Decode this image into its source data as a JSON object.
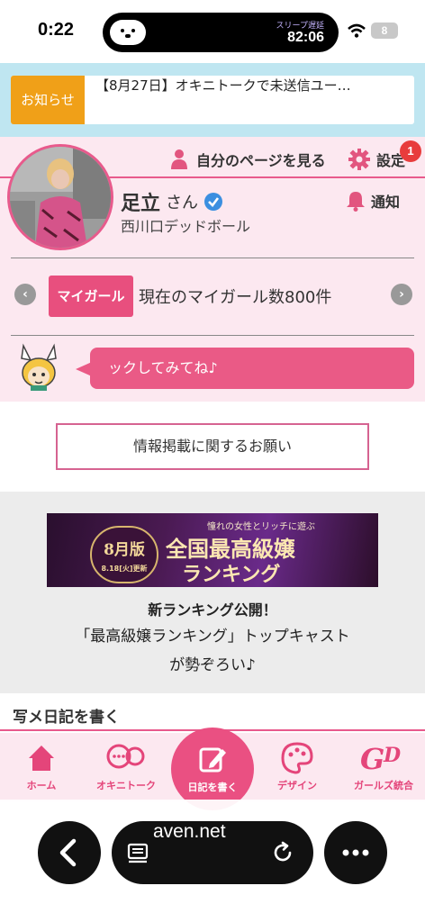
{
  "status_bar": {
    "time": "0:22",
    "island_caption": "スリープ遅延",
    "island_time": "82:06",
    "battery": "8"
  },
  "notice": {
    "tag": "お知らせ",
    "text": "【8月27日】オキニトークで未送信ユー…"
  },
  "profile": {
    "mypage_link": "自分のページを見る",
    "settings_label": "設定",
    "settings_badge": "1",
    "name": "足立",
    "honorific": "さん",
    "shop": "西川口デッドボール",
    "notify_label": "通知"
  },
  "mygirl": {
    "tag": "マイガール",
    "text": "現在のマイガール数800件"
  },
  "mascot_bubble": "ックしてみてね♪",
  "info_button": "情報掲載に関するお願い",
  "banner": {
    "sub": "憧れの女性とリッチに遊ぶ",
    "month": "8月版",
    "date": "8.18[火]更新",
    "title1": "全国最高級嬢",
    "title2": "ランキング",
    "headline": "新ランキング公開！",
    "line1": "「最高級嬢ランキング」トップキャスト",
    "line2": "が勢ぞろい♪"
  },
  "diary": {
    "section_title": "写メ日記を書く",
    "menu": [
      {
        "label": "ホーム",
        "icon": "home-icon"
      },
      {
        "label": "オキニトーク",
        "icon": "chat-icon"
      },
      {
        "label": "日記を書く",
        "icon": "edit-icon"
      },
      {
        "label": "デザイン",
        "icon": "palette-icon"
      },
      {
        "label": "ガールズ統合",
        "icon": "girls-logo-icon"
      }
    ]
  },
  "browser": {
    "url": "aven.net"
  },
  "colors": {
    "accent_pink": "#e85a8c",
    "notice_orange": "#f0a018",
    "notice_band": "#bfe6f1"
  }
}
